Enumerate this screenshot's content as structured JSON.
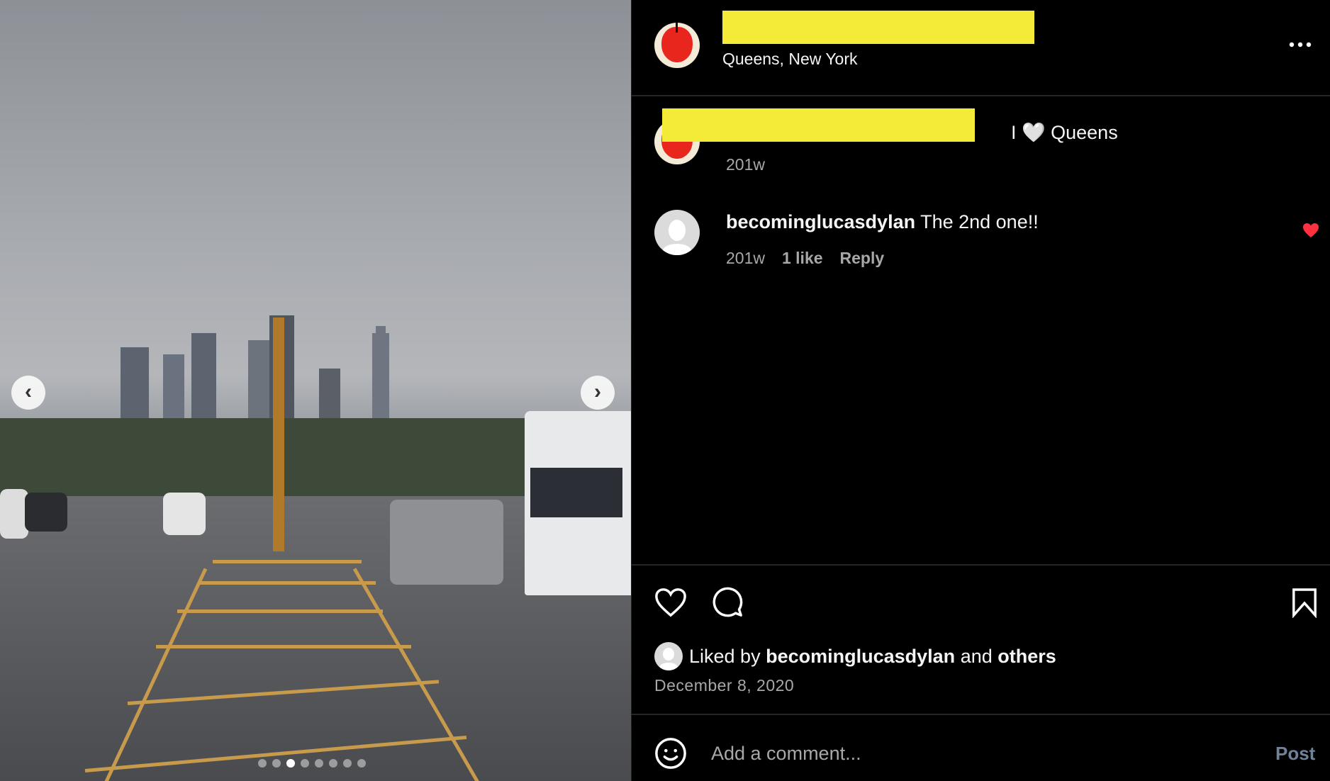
{
  "post": {
    "location": "Queens, New York",
    "caption_text": "I 🤍 Queens",
    "caption_time": "201w",
    "carousel": {
      "total_slides": 8,
      "active_slide": 3
    }
  },
  "comments": [
    {
      "username": "becominglucasdylan",
      "text": "The 2nd one!!",
      "time": "201w",
      "likes": "1 like",
      "reply_label": "Reply",
      "liked": true
    }
  ],
  "likes": {
    "prefix": "Liked by",
    "user": "becominglucasdylan",
    "joiner": "and",
    "others": "others"
  },
  "date": "December 8, 2020",
  "comment_box": {
    "placeholder": "Add a comment...",
    "post_label": "Post"
  },
  "colors": {
    "redaction": "#f4eb38",
    "like_red": "#ff3040",
    "post_blue": "#6f8299"
  }
}
